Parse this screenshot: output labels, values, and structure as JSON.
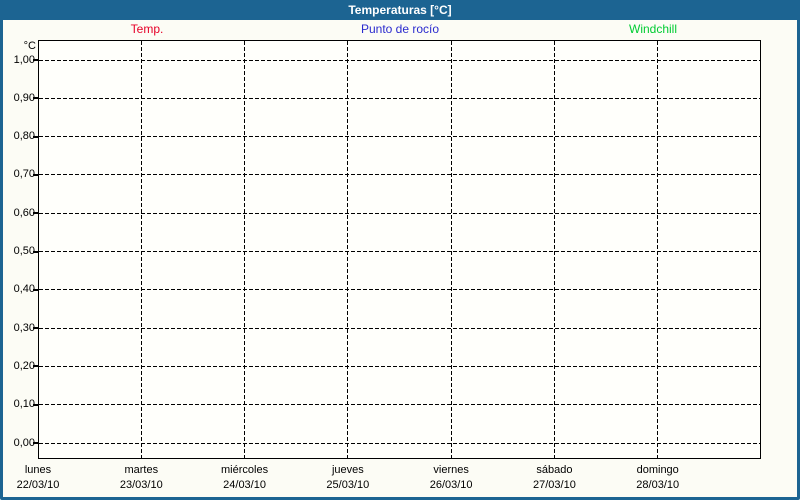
{
  "title_bar": {
    "title": "Temperaturas [°C]"
  },
  "axis": {
    "unit_label": "°C"
  },
  "chart_data": {
    "type": "line",
    "title": "Temperaturas [°C]",
    "ylabel": "°C",
    "ylim": [
      0.0,
      1.0
    ],
    "grid": "dashed",
    "legend_position": "top",
    "y_ticks": [
      {
        "value": 1.0,
        "label": "1,00"
      },
      {
        "value": 0.9,
        "label": "0,90"
      },
      {
        "value": 0.8,
        "label": "0,80"
      },
      {
        "value": 0.7,
        "label": "0,70"
      },
      {
        "value": 0.6,
        "label": "0,60"
      },
      {
        "value": 0.5,
        "label": "0,50"
      },
      {
        "value": 0.4,
        "label": "0,40"
      },
      {
        "value": 0.3,
        "label": "0,30"
      },
      {
        "value": 0.2,
        "label": "0,20"
      },
      {
        "value": 0.1,
        "label": "0,10"
      },
      {
        "value": 0.0,
        "label": "0,00"
      }
    ],
    "x_categories": [
      {
        "day": "lunes",
        "date": "22/03/10"
      },
      {
        "day": "martes",
        "date": "23/03/10"
      },
      {
        "day": "miércoles",
        "date": "24/03/10"
      },
      {
        "day": "jueves",
        "date": "25/03/10"
      },
      {
        "day": "viernes",
        "date": "26/03/10"
      },
      {
        "day": "sábado",
        "date": "27/03/10"
      },
      {
        "day": "domingo",
        "date": "28/03/10"
      }
    ],
    "series": [
      {
        "name": "Temp.",
        "color": "#e60028",
        "values": []
      },
      {
        "name": "Punto de rocío",
        "color": "#2a2ace",
        "values": []
      },
      {
        "name": "Windchill",
        "color": "#00cc33",
        "values": []
      }
    ]
  },
  "colors": {
    "frame_blue": "#1c6492",
    "grid_black": "#000000",
    "background": "#fcfcf5"
  }
}
